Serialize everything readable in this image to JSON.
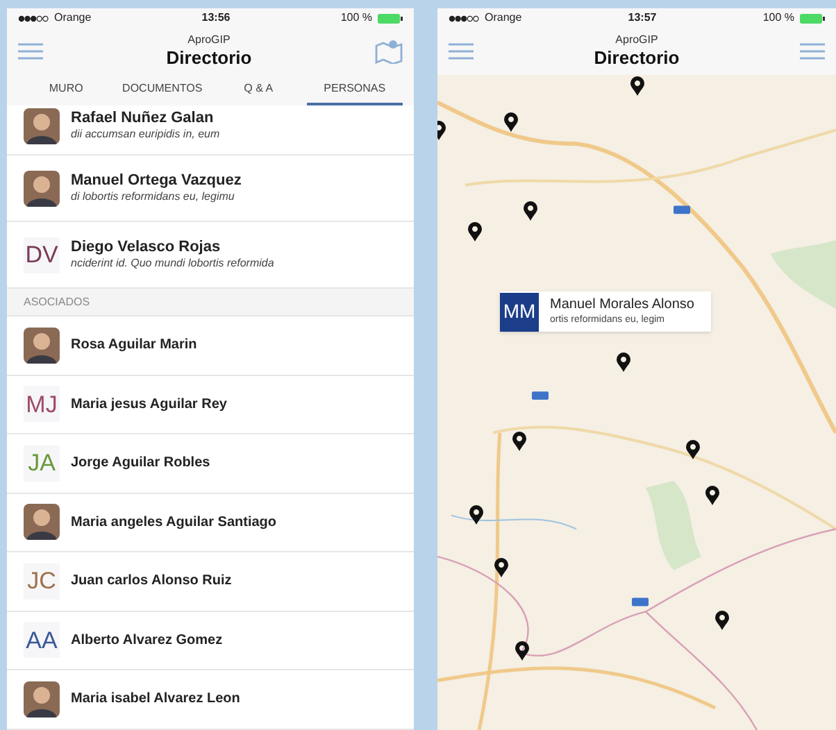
{
  "screens": [
    {
      "status_bar": {
        "carrier": "Orange",
        "time": "13:56",
        "battery": "100 %"
      },
      "app_name": "AproGIP",
      "title": "Directorio",
      "kind": "list",
      "tabs": [
        {
          "label": "MURO",
          "selected": false
        },
        {
          "label": "DOCUMENTOS",
          "selected": false
        },
        {
          "label": "Q & A",
          "selected": false
        },
        {
          "label": "PERSONAS",
          "selected": true
        }
      ],
      "people": [
        {
          "name": "Rafael Nuñez Galan",
          "subtitle": "dii accumsan euripidis in, eum"
        },
        {
          "name": "Manuel Ortega Vazquez",
          "subtitle": "di lobortis reformidans eu, legimu"
        },
        {
          "kind": "initials",
          "initials": "DV",
          "color": "#7a3b55",
          "name": "Diego Velasco Rojas",
          "subtitle": "nciderint id. Quo mundi lobortis reformida"
        }
      ],
      "section": "ASOCIADOS",
      "associates": [
        {
          "name": "Rosa Aguilar Marin"
        },
        {
          "kind": "initials",
          "initials": "MJ",
          "color": "#a04a6a",
          "name": "Maria jesus Aguilar Rey"
        },
        {
          "kind": "initials",
          "initials": "JA",
          "color": "#6a9a3a",
          "name": "Jorge Aguilar Robles"
        },
        {
          "name": "Maria angeles Aguilar Santiago"
        },
        {
          "kind": "initials",
          "initials": "JC",
          "color": "#a0704a",
          "name": "Juan carlos Alonso Ruiz"
        },
        {
          "kind": "initials",
          "initials": "AA",
          "color": "#3a5a9a",
          "name": "Alberto Alvarez Gomez"
        },
        {
          "name": "Maria isabel Alvarez Leon"
        }
      ]
    },
    {
      "status_bar": {
        "carrier": "Orange",
        "time": "13:57",
        "battery": "100 %"
      },
      "app_name": "AproGIP",
      "title": "Directorio",
      "kind": "map",
      "popup": {
        "initials": "MM",
        "name": "Manuel Morales Alonso",
        "subtitle": "ortis reformidans eu, legim"
      }
    }
  ]
}
